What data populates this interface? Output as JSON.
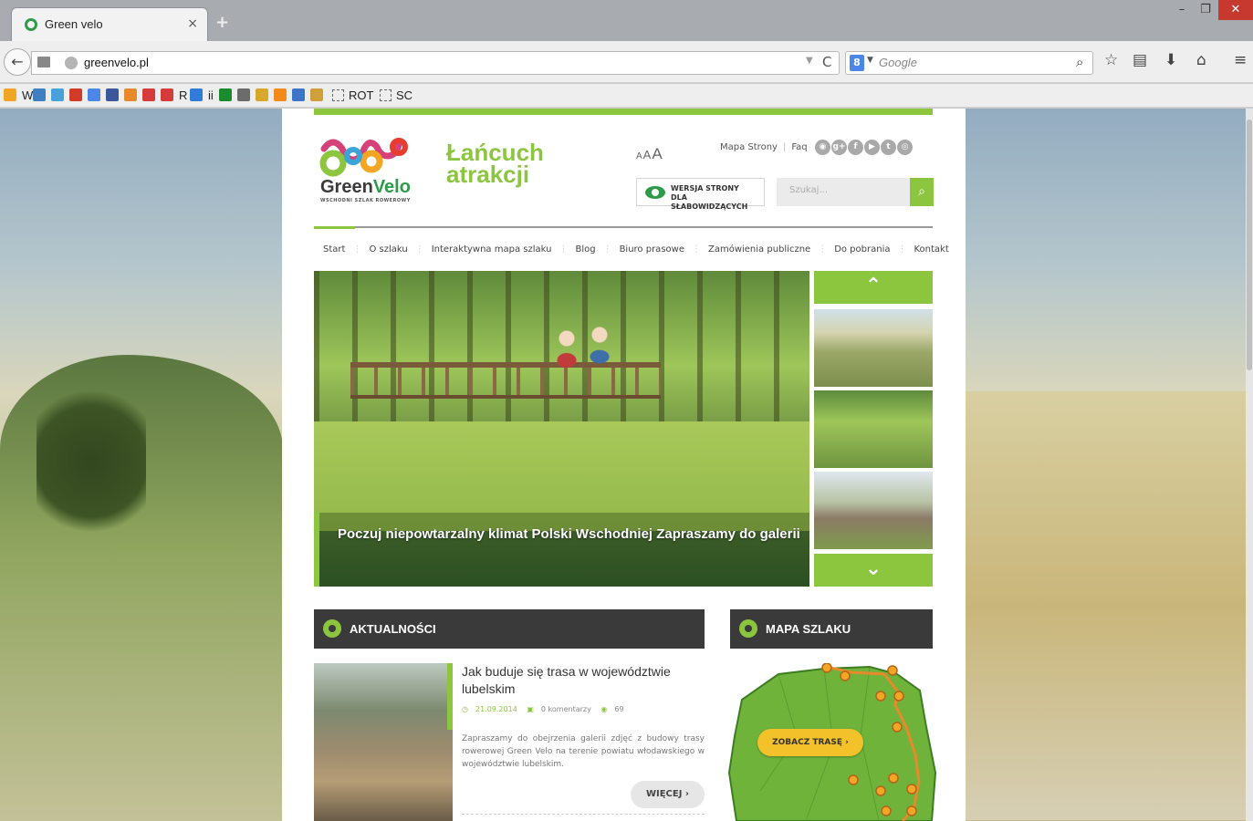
{
  "browser": {
    "tab_title": "Green velo",
    "tab_close": "×",
    "new_tab": "+",
    "url": "greenvelo.pl",
    "search_placeholder": "Google",
    "search_engine_icon": "8",
    "window_controls": {
      "minimize": "–",
      "maximize": "❐",
      "close": "✕"
    },
    "bookmarks": [
      {
        "type": "icon",
        "color": "#f2a623"
      },
      {
        "type": "text",
        "label": "W"
      },
      {
        "type": "icon",
        "color": "#3f7fc0"
      },
      {
        "type": "icon",
        "color": "#4aa0d8"
      },
      {
        "type": "icon",
        "color": "#d23a2a"
      },
      {
        "type": "icon",
        "color": "#4c86e6"
      },
      {
        "type": "icon",
        "color": "#3b5998"
      },
      {
        "type": "icon",
        "color": "#e8892b"
      },
      {
        "type": "icon",
        "color": "#d63b3b"
      },
      {
        "type": "icon",
        "color": "#d63b3b"
      },
      {
        "type": "text",
        "label": "R"
      },
      {
        "type": "icon",
        "color": "#2f7cd6"
      },
      {
        "type": "text",
        "label": "ii"
      },
      {
        "type": "icon",
        "color": "#1a8c2e"
      },
      {
        "type": "icon",
        "color": "#6b6b6b"
      },
      {
        "type": "icon",
        "color": "#d8a82a"
      },
      {
        "type": "icon",
        "color": "#f28a1c"
      },
      {
        "type": "icon",
        "color": "#3b74c8"
      },
      {
        "type": "icon",
        "color": "#cfa03a"
      }
    ],
    "bookmark_folders": [
      "ROT",
      "SC"
    ]
  },
  "site": {
    "colors": {
      "accent": "#8cc63f",
      "dark": "#3a3a3a",
      "brand_green": "#2d9b47",
      "button_yellow": "#f3c12a"
    },
    "logo": {
      "word1": "Green",
      "word2": "Velo",
      "subtitle": "WSCHODNI SZLAK ROWEROWY"
    },
    "slogan": {
      "line1": "Łańcuch",
      "line2": "atrakcji"
    },
    "font_sizes": [
      "A",
      "A",
      "A"
    ],
    "top_links": [
      "Mapa Strony",
      "Faq"
    ],
    "social_icons": [
      "rss-icon",
      "google-plus-icon",
      "facebook-icon",
      "youtube-icon",
      "tumblr-icon",
      "instagram-icon"
    ],
    "social_glyphs": [
      "◉",
      "g+",
      "f",
      "▶",
      "t",
      "◎"
    ],
    "accessibility": {
      "line1": "WERSJA STRONY",
      "line2": "DLA SŁABOWIDZĄCYCH"
    },
    "search_placeholder": "Szukaj...",
    "main_nav": [
      "Start",
      "O szlaku",
      "Interaktywna mapa szlaku",
      "Blog",
      "Biuro prasowe",
      "Zamówienia publiczne",
      "Do pobrania",
      "Kontakt"
    ],
    "hero_caption": "Poczuj niepowtarzalny klimat Polski Wschodniej Zapraszamy do galerii",
    "news_heading": "AKTUALNOŚCI",
    "map_heading": "MAPA SZLAKU",
    "news_item": {
      "title": "Jak buduje się trasa w województwie lubelskim",
      "date": "21.09.2014",
      "comments": "0 komentarzy",
      "views": "69",
      "body": "Zapraszamy do obejrzenia galerii zdjęć z budowy trasy rowerowej Green Velo na terenie powiatu włodawskiego w województwie lubelskim.",
      "more": "WIĘCEJ"
    },
    "map_button": "ZOBACZ TRASĘ"
  }
}
